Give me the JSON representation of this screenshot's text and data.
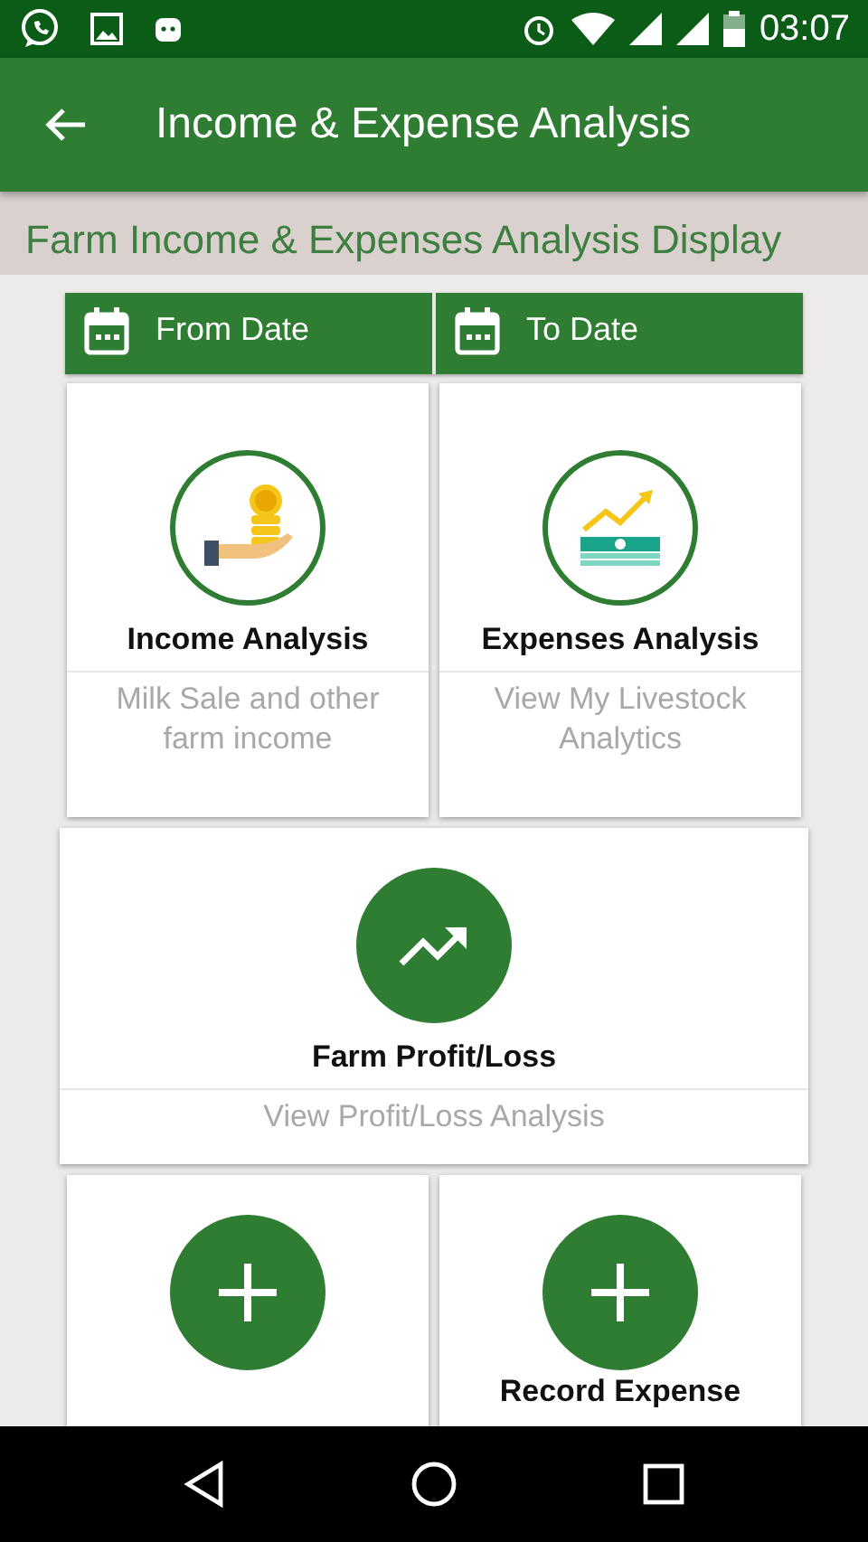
{
  "status_bar": {
    "time": "03:07"
  },
  "app_bar": {
    "title": "Income & Expense Analysis"
  },
  "subtitle": "Farm Income & Expenses Analysis Display",
  "date_buttons": [
    {
      "label": "From Date"
    },
    {
      "label": "To Date"
    }
  ],
  "card_rows": [
    [
      {
        "kind": "income",
        "title": "Income Analysis",
        "description": "Milk Sale and other farm income"
      },
      {
        "kind": "expenses",
        "title": "Expenses Analysis",
        "description": "View My Livestock Analytics"
      }
    ],
    [
      {
        "kind": "profit",
        "title": "Farm Profit/Loss",
        "description": "View Profit/Loss Analysis"
      }
    ],
    [
      {
        "kind": "add"
      },
      {
        "kind": "add",
        "title": "Record Expense"
      }
    ]
  ]
}
